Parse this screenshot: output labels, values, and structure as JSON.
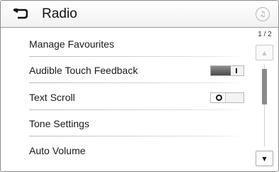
{
  "header": {
    "title": "Radio",
    "back_icon": "back-arrow-icon",
    "media_icon": "music-note-icon"
  },
  "menu": {
    "items": [
      {
        "label": "Manage Favourites"
      },
      {
        "label": "Audible Touch Feedback",
        "toggle": true,
        "state": "on"
      },
      {
        "label": "Text Scroll",
        "toggle": true,
        "state": "off"
      },
      {
        "label": "Tone Settings"
      },
      {
        "label": "Auto Volume"
      }
    ]
  },
  "scroll": {
    "page_indicator": "1 / 2",
    "up_icon": "scroll-up-arrow-icon",
    "down_icon": "scroll-down-arrow-icon"
  },
  "colors": {
    "toggle_on": "#5a5a5a",
    "scroll_thumb": "#8a8a8a",
    "border": "#8a8a8a"
  }
}
